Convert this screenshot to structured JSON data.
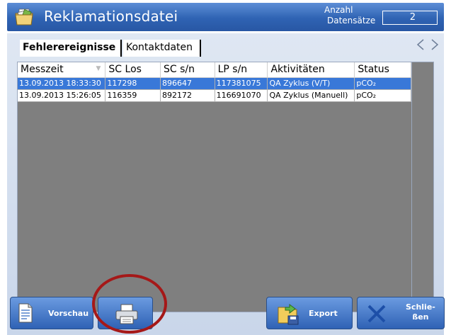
{
  "header": {
    "title": "Reklamationsdatei",
    "count_label_line1": "Anzahl",
    "count_label_line2": "Datensätze",
    "count_value": "2",
    "app_icon": "complaint-file-icon"
  },
  "tabs": [
    {
      "label": "Fehlerereignisse",
      "active": true
    },
    {
      "label": "Kontaktdaten",
      "active": false
    }
  ],
  "nav": {
    "prev_icon": "chevron-left-icon",
    "next_icon": "chevron-right-icon"
  },
  "table": {
    "columns": [
      "Messzeit",
      "SC Los",
      "SC s/n",
      "LP s/n",
      "Aktivitäten",
      "Status"
    ],
    "rows": [
      {
        "messzeit": "13.09.2013 18:33:30",
        "sc_los": "117298",
        "sc_sn": "896647",
        "lp_sn": "117381075",
        "aktivitaeten": "QA Zyklus (V/T)",
        "status": "pCO₂",
        "selected": true
      },
      {
        "messzeit": "13.09.2013 15:26:05",
        "sc_los": "116359",
        "sc_sn": "892172",
        "lp_sn": "116691070",
        "aktivitaeten": "QA Zyklus (Manuell)",
        "status": "pCO₂",
        "selected": false
      }
    ]
  },
  "buttons": {
    "preview_label": "Vorschau",
    "export_label": "Export",
    "close_label_line1": "Schlie-",
    "close_label_line2": "ßen"
  },
  "colors": {
    "header_blue": "#2f63b3",
    "selected_row": "#3978d8",
    "highlight_circle": "#a51818"
  }
}
